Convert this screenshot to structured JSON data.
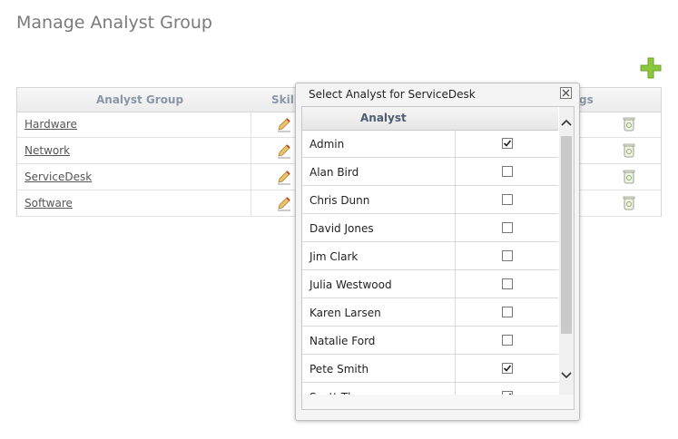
{
  "page": {
    "title": "Manage Analyst Group"
  },
  "colors": {
    "accent_add": "#8dc63f",
    "header_text": "#8a96a8",
    "link": "#555555"
  },
  "table": {
    "headers": {
      "group": "Analyst Group",
      "skills": "Skill",
      "settings": "gs"
    },
    "rows": [
      {
        "name": "Hardware"
      },
      {
        "name": "Network"
      },
      {
        "name": "ServiceDesk"
      },
      {
        "name": "Software"
      }
    ]
  },
  "dialog": {
    "title": "Select Analyst for ServiceDesk",
    "column_header": "Analyst",
    "analysts": [
      {
        "name": "Admin",
        "checked": true
      },
      {
        "name": "Alan Bird",
        "checked": false
      },
      {
        "name": "Chris Dunn",
        "checked": false
      },
      {
        "name": "David Jones",
        "checked": false
      },
      {
        "name": "Jim Clark",
        "checked": false
      },
      {
        "name": "Julia Westwood",
        "checked": false
      },
      {
        "name": "Karen Larsen",
        "checked": false
      },
      {
        "name": "Natalie Ford",
        "checked": false
      },
      {
        "name": "Pete Smith",
        "checked": true
      },
      {
        "name": "Scott Thompson",
        "checked": true
      }
    ]
  },
  "icons": {
    "add": "plus-icon",
    "edit": "pencil-icon",
    "delete": "trash-icon",
    "close": "close-icon",
    "scroll_up": "chevron-up-icon",
    "scroll_down": "chevron-down-icon"
  }
}
